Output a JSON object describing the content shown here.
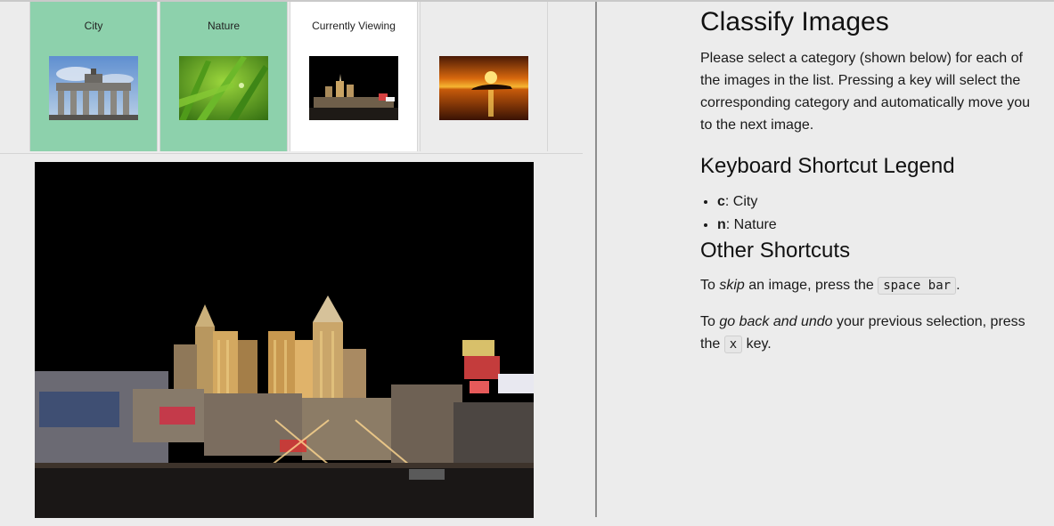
{
  "thumbnails": [
    {
      "label": "City",
      "state": "labeled",
      "image": "berlin-gate-thumbnail"
    },
    {
      "label": "Nature",
      "state": "labeled",
      "image": "green-grass-thumbnail"
    },
    {
      "label": "Currently Viewing",
      "state": "current",
      "image": "night-city-thumbnail"
    },
    {
      "label": "",
      "state": "unlabeled",
      "image": "sunset-lake-thumbnail"
    }
  ],
  "main_image": {
    "image": "night-city-skyline-image"
  },
  "instructions": {
    "title": "Classify Images",
    "intro": "Please select a category (shown below) for each of the images in the list. Pressing a key will select the corresponding category and automatically move you to the next image.",
    "legend_title": "Keyboard Shortcut Legend",
    "legend": [
      {
        "key": "c",
        "label": ": City"
      },
      {
        "key": "n",
        "label": ": Nature"
      }
    ],
    "other_title": "Other Shortcuts",
    "skip": {
      "pre": "To ",
      "em": "skip",
      "mid": " an image, press the ",
      "key": "space bar",
      "post": "."
    },
    "undo": {
      "pre": "To ",
      "em": "go back and undo",
      "mid": " your previous selection, press the ",
      "key": "x",
      "post": " key."
    }
  },
  "colors": {
    "labeled": "#8dd1ac",
    "current": "#ffffff",
    "divider": "#8e8e8e"
  }
}
